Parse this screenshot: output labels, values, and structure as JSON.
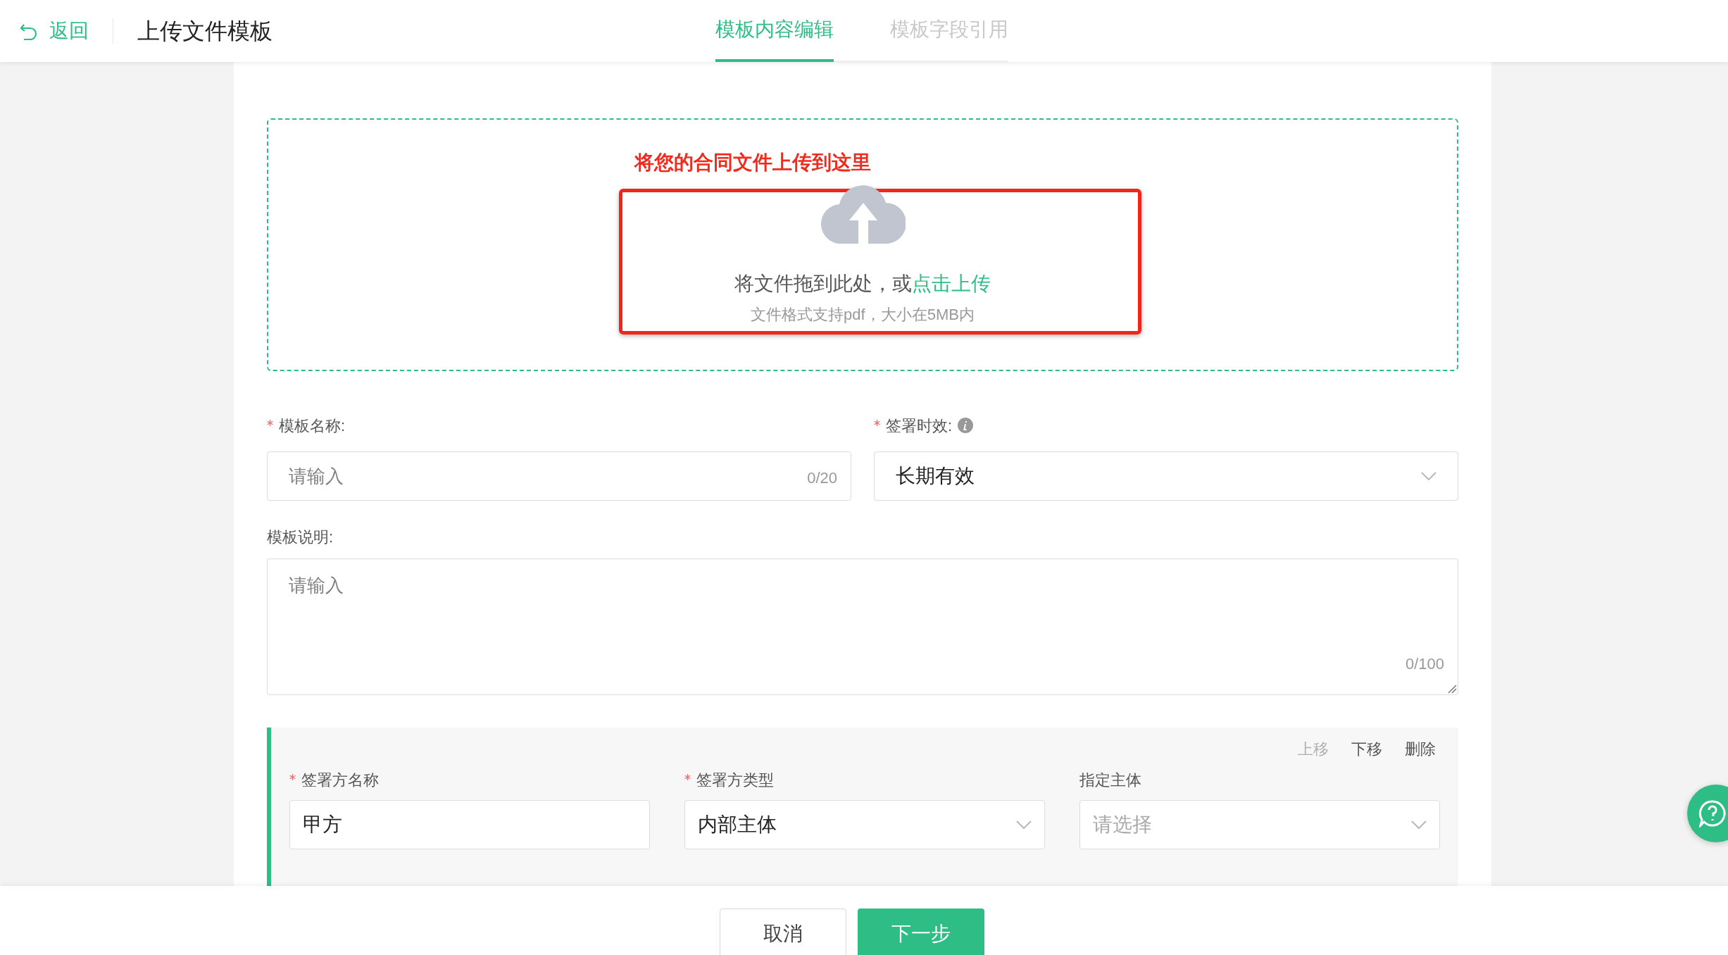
{
  "header": {
    "back": "返回",
    "title": "上传文件模板"
  },
  "tabs": [
    {
      "label": "模板内容编辑",
      "selected": true
    },
    {
      "label": "模板字段引用",
      "selected": false
    }
  ],
  "upload": {
    "annotation": "将您的合同文件上传到这里",
    "prompt": "将文件拖到此处，或",
    "link": "点击上传",
    "hint": "文件格式支持pdf，大小在5MB内"
  },
  "form": {
    "name": {
      "label": "模板名称:",
      "required": true,
      "placeholder": "请输入",
      "counter": "0/20"
    },
    "validity": {
      "label": "签署时效:",
      "required": true,
      "value": "长期有效"
    },
    "description": {
      "label": "模板说明:",
      "required": false,
      "placeholder": "请输入",
      "counter": "0/100"
    }
  },
  "party": {
    "actions": [
      {
        "label": "上移",
        "disabled": true
      },
      {
        "label": "下移",
        "disabled": false
      },
      {
        "label": "删除",
        "disabled": false
      }
    ],
    "fields": [
      {
        "kind": "input",
        "label": "签署方名称",
        "required": true,
        "value": "甲方"
      },
      {
        "kind": "select",
        "label": "签署方类型",
        "required": true,
        "value": "内部主体"
      },
      {
        "kind": "select",
        "label": "指定主体",
        "required": false,
        "placeholder": "请选择"
      }
    ]
  },
  "footer": {
    "buttons": [
      {
        "label": "取消",
        "kind": "secondary"
      },
      {
        "label": "下一步",
        "kind": "primary"
      }
    ]
  }
}
